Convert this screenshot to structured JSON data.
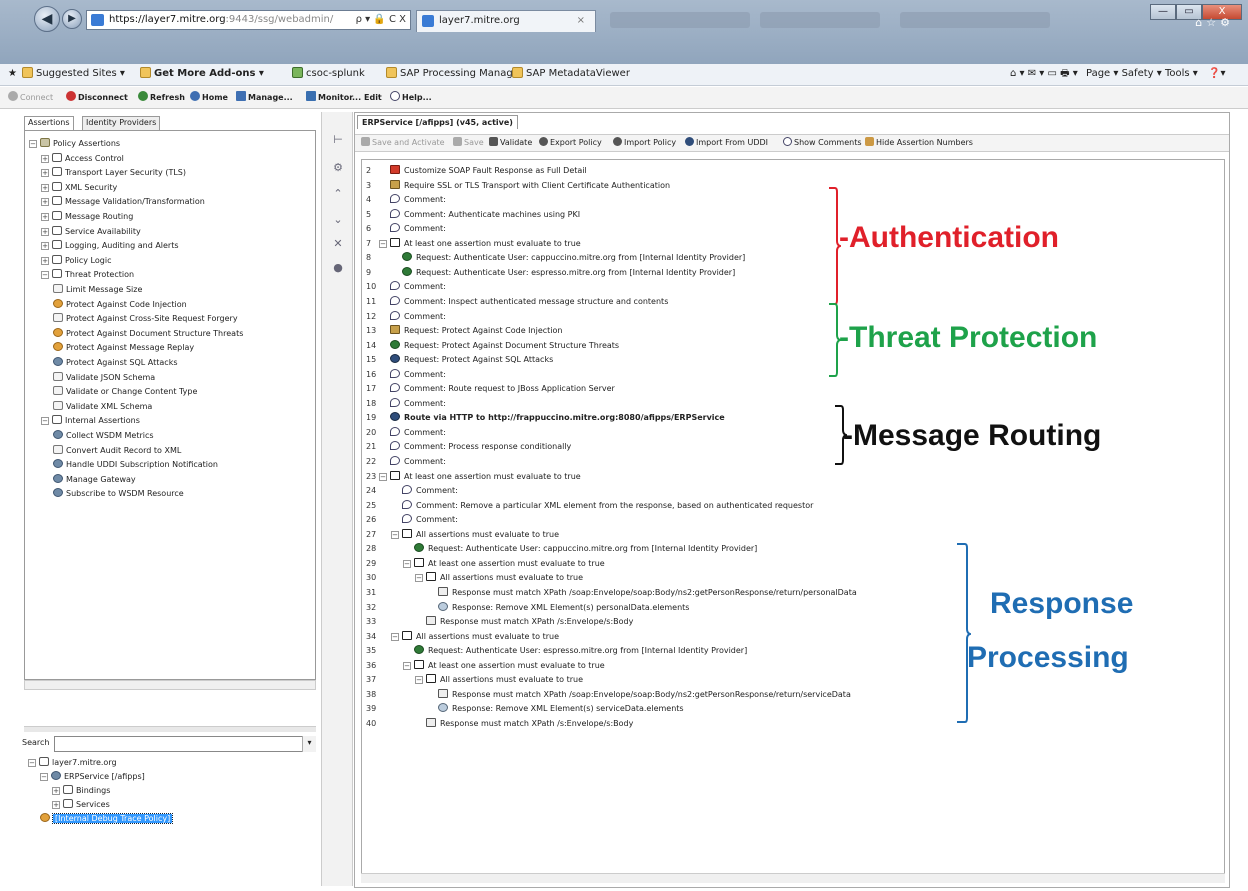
{
  "browser": {
    "url_visible": "https://layer7.mitre.org",
    "url_dim": ":9443/ssg/webadmin/",
    "addr_tools": "ρ ▾ 🔒 C X",
    "tab_title": "layer7.mitre.org",
    "tab_close": "×",
    "window_buttons": [
      "—",
      "▭",
      "X"
    ],
    "favorites": [
      {
        "label": "Suggested Sites ▾",
        "bold": false
      },
      {
        "label": "Get More Add-ons ▾",
        "bold": true
      },
      {
        "label": "csoc-splunk",
        "bold": false
      },
      {
        "label": "SAP Processing Manager",
        "bold": false
      },
      {
        "label": "SAP MetadataViewer",
        "bold": false
      }
    ],
    "command_bar": "Page ▾  Safety ▾  Tools ▾"
  },
  "app_toolbar": [
    {
      "label": "Connect",
      "disabled": true
    },
    {
      "label": "Disconnect",
      "disabled": false
    },
    {
      "label": "Refresh",
      "disabled": false
    },
    {
      "label": "Home",
      "disabled": false
    },
    {
      "label": "Manage...",
      "disabled": false
    },
    {
      "label": "Monitor...",
      "disabled": false
    },
    {
      "label": "Edit",
      "disabled": false
    },
    {
      "label": "Help...",
      "disabled": false
    }
  ],
  "left_panel": {
    "tabs": [
      "Assertions",
      "Identity Providers"
    ],
    "assertion_tree": [
      {
        "label": "Policy Assertions",
        "level": 0,
        "exp": "−",
        "icon": "shield"
      },
      {
        "label": "Access Control",
        "level": 1,
        "exp": "+",
        "icon": "folder"
      },
      {
        "label": "Transport Layer Security (TLS)",
        "level": 1,
        "exp": "+",
        "icon": "folder"
      },
      {
        "label": "XML Security",
        "level": 1,
        "exp": "+",
        "icon": "folder"
      },
      {
        "label": "Message Validation/Transformation",
        "level": 1,
        "exp": "+",
        "icon": "folder"
      },
      {
        "label": "Message Routing",
        "level": 1,
        "exp": "+",
        "icon": "folder"
      },
      {
        "label": "Service Availability",
        "level": 1,
        "exp": "+",
        "icon": "folder"
      },
      {
        "label": "Logging, Auditing and Alerts",
        "level": 1,
        "exp": "+",
        "icon": "folder"
      },
      {
        "label": "Policy Logic",
        "level": 1,
        "exp": "+",
        "icon": "folder"
      },
      {
        "label": "Threat Protection",
        "level": 1,
        "exp": "−",
        "icon": "folder"
      },
      {
        "label": "Limit Message Size",
        "level": 2,
        "exp": "",
        "icon": "doc"
      },
      {
        "label": "Protect Against Code Injection",
        "level": 2,
        "exp": "",
        "icon": "prot"
      },
      {
        "label": "Protect Against Cross-Site Request Forgery",
        "level": 2,
        "exp": "",
        "icon": "doc"
      },
      {
        "label": "Protect Against Document Structure Threats",
        "level": 2,
        "exp": "",
        "icon": "prot"
      },
      {
        "label": "Protect Against Message Replay",
        "level": 2,
        "exp": "",
        "icon": "prot"
      },
      {
        "label": "Protect Against SQL Attacks",
        "level": 2,
        "exp": "",
        "icon": "gear"
      },
      {
        "label": "Validate JSON Schema",
        "level": 2,
        "exp": "",
        "icon": "doc"
      },
      {
        "label": "Validate or Change Content Type",
        "level": 2,
        "exp": "",
        "icon": "doc"
      },
      {
        "label": "Validate XML Schema",
        "level": 2,
        "exp": "",
        "icon": "doc"
      },
      {
        "label": "Internal Assertions",
        "level": 1,
        "exp": "−",
        "icon": "folder"
      },
      {
        "label": "Collect WSDM Metrics",
        "level": 2,
        "exp": "",
        "icon": "gear"
      },
      {
        "label": "Convert Audit Record to XML",
        "level": 2,
        "exp": "",
        "icon": "doc"
      },
      {
        "label": "Handle UDDI Subscription Notification",
        "level": 2,
        "exp": "",
        "icon": "gear"
      },
      {
        "label": "Manage Gateway",
        "level": 2,
        "exp": "",
        "icon": "gear"
      },
      {
        "label": "Subscribe to WSDM Resource",
        "level": 2,
        "exp": "",
        "icon": "gear"
      }
    ],
    "search_label": "Search",
    "search_value": "",
    "services_tree": [
      {
        "label": "layer7.mitre.org",
        "level": 0,
        "exp": "−",
        "icon": "folder"
      },
      {
        "label": "ERPService [/afipps]",
        "level": 1,
        "exp": "−",
        "icon": "gear"
      },
      {
        "label": "Bindings",
        "level": 2,
        "exp": "+",
        "icon": "folder"
      },
      {
        "label": "Services",
        "level": 2,
        "exp": "+",
        "icon": "folder"
      },
      {
        "label": "[Internal Debug Trace Policy]",
        "level": 1,
        "exp": "",
        "icon": "prot",
        "selected": true
      }
    ]
  },
  "editor": {
    "tab_title": "ERPService [/afipps] (v45, active)",
    "toolbar": [
      {
        "label": "Save and Activate",
        "disabled": true
      },
      {
        "label": "Save",
        "disabled": true
      },
      {
        "label": "Validate",
        "disabled": false
      },
      {
        "label": "Export Policy",
        "disabled": false
      },
      {
        "label": "Import Policy",
        "disabled": false
      },
      {
        "label": "Import From UDDI",
        "disabled": false
      },
      {
        "label": "Show Comments",
        "disabled": false
      },
      {
        "label": "Hide Assertion Numbers",
        "disabled": false
      }
    ],
    "lines": [
      {
        "n": "2",
        "depth": 0,
        "icon": "fault",
        "text": "Customize SOAP Fault Response as Full Detail"
      },
      {
        "n": "3",
        "depth": 0,
        "icon": "ssl",
        "text": "Require SSL or TLS Transport with Client Certificate Authentication"
      },
      {
        "n": "4",
        "depth": 0,
        "icon": "comment",
        "text": "Comment:"
      },
      {
        "n": "5",
        "depth": 0,
        "icon": "comment",
        "text": "Comment: Authenticate machines using PKI"
      },
      {
        "n": "6",
        "depth": 0,
        "icon": "comment",
        "text": "Comment:"
      },
      {
        "n": "7",
        "depth": 0,
        "icon": "all",
        "exp": "−",
        "text": "At least one assertion must evaluate to true"
      },
      {
        "n": "8",
        "depth": 1,
        "icon": "user",
        "text": "Request: Authenticate User: cappuccino.mitre.org from [Internal Identity Provider]"
      },
      {
        "n": "9",
        "depth": 1,
        "icon": "user",
        "text": "Request: Authenticate User: espresso.mitre.org from [Internal Identity Provider]"
      },
      {
        "n": "10",
        "depth": 0,
        "icon": "comment",
        "text": "Comment:"
      },
      {
        "n": "11",
        "depth": 0,
        "icon": "comment",
        "text": "Comment: Inspect authenticated message structure and contents"
      },
      {
        "n": "12",
        "depth": 0,
        "icon": "comment",
        "text": "Comment:"
      },
      {
        "n": "13",
        "depth": 0,
        "icon": "ssl",
        "text": "Request: Protect Against Code Injection"
      },
      {
        "n": "14",
        "depth": 0,
        "icon": "user",
        "text": "Request: Protect Against Document Structure Threats"
      },
      {
        "n": "15",
        "depth": 0,
        "icon": "route",
        "text": "Request: Protect Against SQL Attacks"
      },
      {
        "n": "16",
        "depth": 0,
        "icon": "comment",
        "text": "Comment:"
      },
      {
        "n": "17",
        "depth": 0,
        "icon": "comment",
        "text": "Comment: Route request to JBoss Application Server"
      },
      {
        "n": "18",
        "depth": 0,
        "icon": "comment",
        "text": "Comment:"
      },
      {
        "n": "19",
        "depth": 0,
        "icon": "route",
        "bold": true,
        "text": "Route via HTTP to http://frappuccino.mitre.org:8080/afipps/ERPService"
      },
      {
        "n": "20",
        "depth": 0,
        "icon": "comment",
        "text": "Comment:"
      },
      {
        "n": "21",
        "depth": 0,
        "icon": "comment",
        "text": "Comment: Process response conditionally"
      },
      {
        "n": "22",
        "depth": 0,
        "icon": "comment",
        "text": "Comment:"
      },
      {
        "n": "23",
        "depth": 0,
        "icon": "all",
        "exp": "−",
        "text": "At least one assertion must evaluate to true"
      },
      {
        "n": "24",
        "depth": 1,
        "icon": "comment",
        "text": "Comment:"
      },
      {
        "n": "25",
        "depth": 1,
        "icon": "comment",
        "text": "Comment: Remove a particular XML element from the response, based on authenticated requestor"
      },
      {
        "n": "26",
        "depth": 1,
        "icon": "comment",
        "text": "Comment:"
      },
      {
        "n": "27",
        "depth": 1,
        "icon": "all",
        "exp": "−",
        "text": "All assertions must evaluate to true"
      },
      {
        "n": "28",
        "depth": 2,
        "icon": "user",
        "text": "Request: Authenticate User: cappuccino.mitre.org from [Internal Identity Provider]"
      },
      {
        "n": "29",
        "depth": 2,
        "icon": "all",
        "exp": "−",
        "text": "At least one assertion must evaluate to true"
      },
      {
        "n": "30",
        "depth": 3,
        "icon": "all",
        "exp": "−",
        "text": "All assertions must evaluate to true"
      },
      {
        "n": "31",
        "depth": 4,
        "icon": "xpath",
        "text": "Response must match XPath /soap:Envelope/soap:Body/ns2:getPersonResponse/return/personalData"
      },
      {
        "n": "32",
        "depth": 4,
        "icon": "remove",
        "text": "Response: Remove XML Element(s) personalData.elements"
      },
      {
        "n": "33",
        "depth": 3,
        "icon": "xpath",
        "text": "Response must match XPath /s:Envelope/s:Body"
      },
      {
        "n": "34",
        "depth": 1,
        "icon": "all",
        "exp": "−",
        "text": "All assertions must evaluate to true"
      },
      {
        "n": "35",
        "depth": 2,
        "icon": "user",
        "text": "Request: Authenticate User: espresso.mitre.org from [Internal Identity Provider]"
      },
      {
        "n": "36",
        "depth": 2,
        "icon": "all",
        "exp": "−",
        "text": "At least one assertion must evaluate to true"
      },
      {
        "n": "37",
        "depth": 3,
        "icon": "all",
        "exp": "−",
        "text": "All assertions must evaluate to true"
      },
      {
        "n": "38",
        "depth": 4,
        "icon": "xpath",
        "text": "Response must match XPath /soap:Envelope/soap:Body/ns2:getPersonResponse/return/serviceData"
      },
      {
        "n": "39",
        "depth": 4,
        "icon": "remove",
        "text": "Response: Remove XML Element(s) serviceData.elements"
      },
      {
        "n": "40",
        "depth": 3,
        "icon": "xpath",
        "text": "Response must match XPath /s:Envelope/s:Body"
      }
    ]
  },
  "annotations": {
    "authentication": "-Authentication",
    "threat_protection": "-Threat Protection",
    "message_routing": "-Message Routing",
    "response_line1": "Response",
    "response_line2": "Processing",
    "colors": {
      "authentication": "#e0202a",
      "threat_protection": "#1ea24a",
      "message_routing": "#111111",
      "response_processing": "#1f6db3"
    }
  }
}
